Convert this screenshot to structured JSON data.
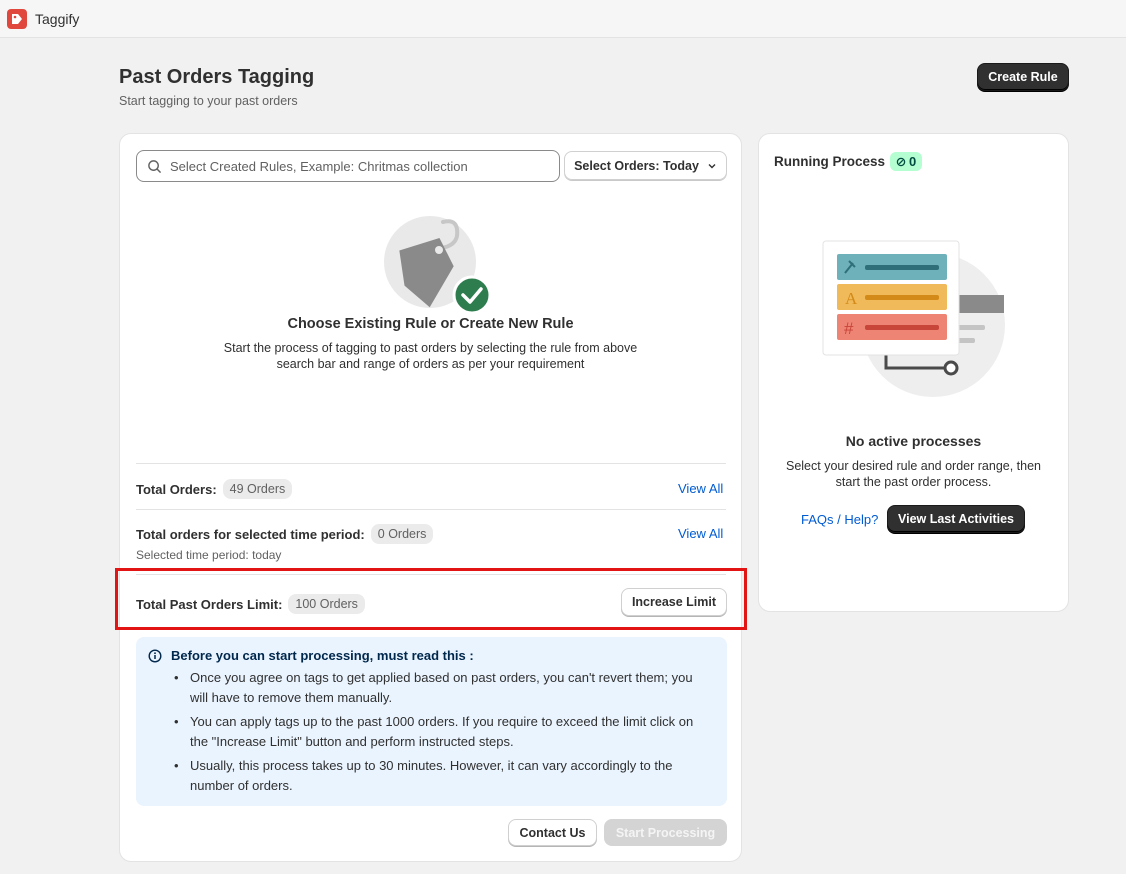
{
  "app": {
    "name": "Taggify"
  },
  "header": {
    "title": "Past Orders Tagging",
    "subtitle": "Start tagging to your past orders",
    "create_rule": "Create Rule"
  },
  "search": {
    "placeholder": "Select Created Rules, Example: Chritmas collection"
  },
  "select_orders": {
    "label": "Select Orders: Today"
  },
  "empty_state": {
    "title": "Choose Existing Rule or Create New Rule",
    "description": "Start the process of tagging to past orders by selecting the rule from above search bar and range of orders as per your requirement"
  },
  "stats": {
    "total_orders_label": "Total Orders:",
    "total_orders_value": "49 Orders",
    "view_all_1": "View All",
    "selected_label": "Total orders for selected time period:",
    "selected_value": "0 Orders",
    "view_all_2": "View All",
    "selected_period_note": "Selected time period: today",
    "limit_label": "Total Past Orders Limit:",
    "limit_value": "100 Orders",
    "increase_limit": "Increase Limit"
  },
  "info": {
    "title": "Before you can start processing, must read this :",
    "items": [
      "Once you agree on tags to get applied based on past orders, you can't revert them; you will have to remove them manually.",
      "You can apply tags up to the past 1000 orders. If you require to exceed the limit click on the \"Increase Limit\" button and perform instructed steps.",
      "Usually, this process takes up to 30 minutes. However, it can vary accordingly to the number of orders."
    ]
  },
  "actions": {
    "contact_us": "Contact Us",
    "start_processing": "Start Processing"
  },
  "running": {
    "title": "Running Process",
    "count": "0",
    "none_title": "No active processes",
    "none_desc": "Select your desired rule and order range, then start the past order process.",
    "faq": "FAQs / Help?",
    "view_last": "View Last Activities"
  },
  "colors": {
    "accent_dark": "#303030",
    "link": "#005bd3",
    "highlight": "#e21414",
    "success": "#2e7d4f"
  }
}
